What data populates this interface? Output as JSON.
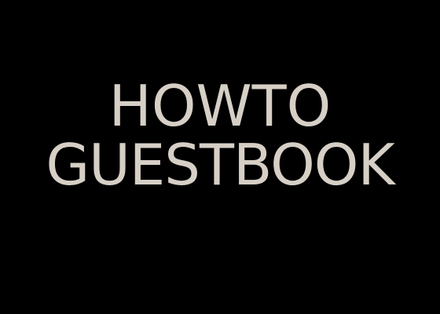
{
  "heading": {
    "line1": "HOWTO",
    "line2": "GUESTBOOK"
  },
  "colors": {
    "background": "#000000",
    "text": "#d6cfc6"
  }
}
